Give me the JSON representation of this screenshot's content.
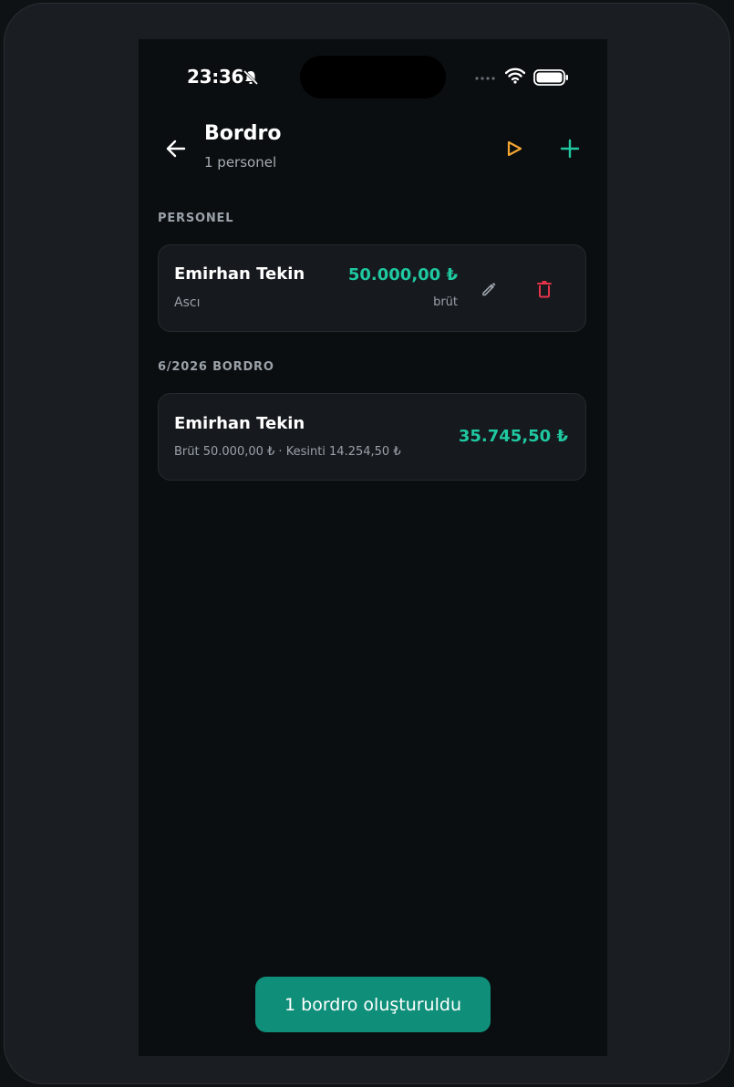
{
  "status_bar": {
    "time": "23:36",
    "icons": [
      "bell-off-icon",
      "signal-icon",
      "wifi-icon",
      "battery-icon"
    ]
  },
  "header": {
    "title": "Bordro",
    "subtitle": "1 personel",
    "icons": [
      "back-icon",
      "play-icon",
      "plus-icon"
    ]
  },
  "sections": {
    "personnel_label": "PERSONEL",
    "payroll_label": "6/2026 BORDRO"
  },
  "personnel": {
    "name": "Emirhan Tekin",
    "role": "Ascı",
    "amount": "50.000,00 ₺",
    "amount_note": "brüt",
    "icons": [
      "edit-icon",
      "delete-icon"
    ]
  },
  "payroll": {
    "name": "Emirhan Tekin",
    "details": "Brüt 50.000,00 ₺ · Kesinti 14.254,50 ₺",
    "net": "35.745,50 ₺"
  },
  "toast": {
    "message": "1 bordro oluşturuldu"
  },
  "colors": {
    "accent": "#1fc8a0",
    "play": "#f3a531",
    "danger": "#e5344a",
    "toast_bg": "#0f8f7a"
  }
}
